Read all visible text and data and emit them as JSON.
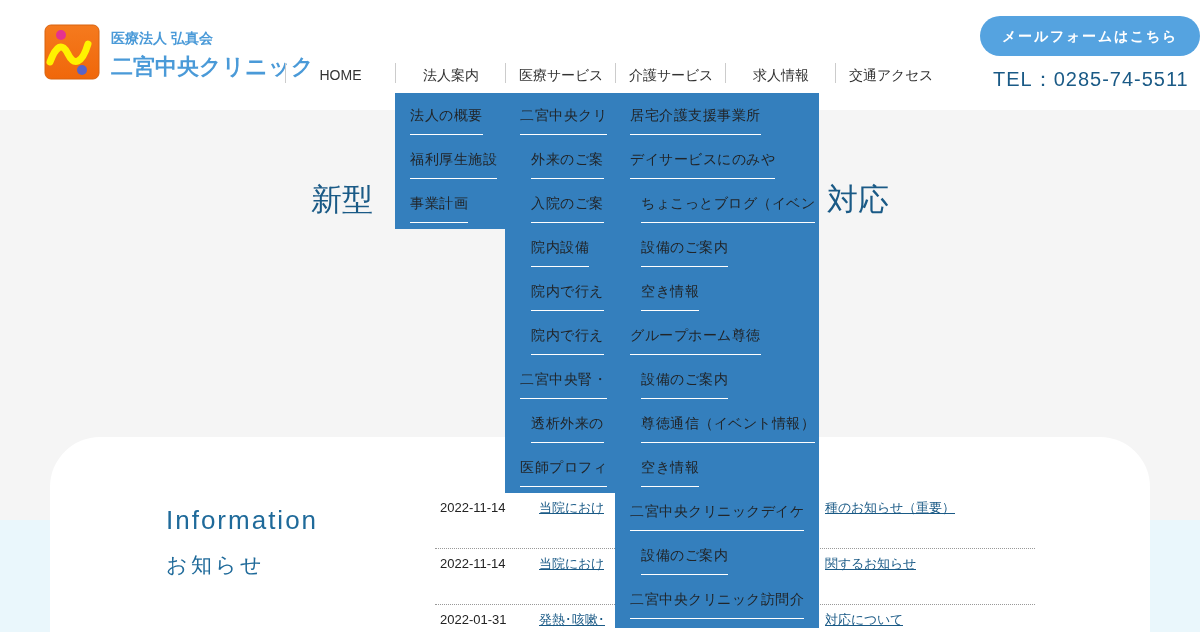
{
  "header": {
    "org": "医療法人 弘真会",
    "clinic": "二宮中央クリニック",
    "mail_button": "メールフォームはこちら",
    "tel": "TEL：0285-74-5511"
  },
  "nav": [
    {
      "label": "HOME"
    },
    {
      "label": "法人案内",
      "expanded": true,
      "children": [
        {
          "label": "法人の概要"
        },
        {
          "label": "福利厚生施設"
        },
        {
          "label": "事業計画"
        }
      ]
    },
    {
      "label": "医療サービス",
      "expanded": true,
      "children": [
        {
          "label": "二宮中央クリ",
          "children": [
            {
              "label": "外来のご案"
            },
            {
              "label": "入院のご案"
            },
            {
              "label": "院内設備"
            },
            {
              "label": "院内で行え"
            },
            {
              "label": "院内で行え"
            }
          ]
        },
        {
          "label": "二宮中央腎・",
          "children": [
            {
              "label": "透析外来の"
            }
          ]
        },
        {
          "label": "医師プロフィ"
        }
      ]
    },
    {
      "label": "介護サービス",
      "expanded": true,
      "children": [
        {
          "label": "居宅介護支援事業所"
        },
        {
          "label": "デイサービスにのみや",
          "children": [
            {
              "label": "ちょこっとブログ（イベン"
            },
            {
              "label": "設備のご案内"
            },
            {
              "label": "空き情報"
            }
          ]
        },
        {
          "label": "グループホーム尊徳",
          "children": [
            {
              "label": "設備のご案内"
            },
            {
              "label": "尊徳通信（イベント情報）"
            },
            {
              "label": "空き情報"
            }
          ]
        },
        {
          "label": "二宮中央クリニックデイケ",
          "children": [
            {
              "label": "設備のご案内"
            }
          ]
        },
        {
          "label": "二宮中央クリニック訪問介"
        }
      ]
    },
    {
      "label": "求人情報"
    },
    {
      "label": "交通アクセス"
    }
  ],
  "page_title": {
    "start": "新型",
    "end": "対応"
  },
  "information": {
    "title": "Information",
    "subtitle": "お知らせ",
    "news": [
      {
        "date": "2022-11-14",
        "title_start": "当院におけ",
        "title_end": "種のお知らせ（重要）"
      },
      {
        "date": "2022-11-14",
        "title_start": "当院におけ",
        "title_end": "関するお知らせ"
      },
      {
        "date": "2022-01-31",
        "title_start": "発熱･咳嗽･",
        "title_end": "対応について"
      }
    ]
  }
}
